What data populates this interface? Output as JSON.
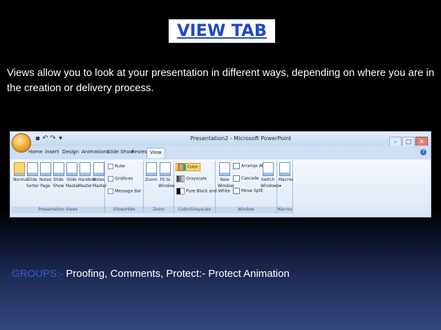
{
  "slide": {
    "title": "VIEW TAB",
    "intro": "Views allow you to look at your presentation in different ways, depending on where you are in the creation or delivery process.",
    "groups_label": "GROUPS:-",
    "groups_text": "Proofing, Comments, Protect:- Protect Animation"
  },
  "window": {
    "title": "Presentation2 - Microsoft PowerPoint",
    "tabs": [
      "Home",
      "Insert",
      "Design",
      "Animations",
      "Slide Show",
      "Review",
      "View"
    ],
    "active_tab": "View"
  },
  "ribbon": {
    "presentation_views": {
      "label": "Presentation Views",
      "buttons": [
        {
          "line1": "Normal",
          "line2": ""
        },
        {
          "line1": "Slide",
          "line2": "Sorter"
        },
        {
          "line1": "Notes",
          "line2": "Page"
        },
        {
          "line1": "Slide",
          "line2": "Show"
        },
        {
          "line1": "Slide",
          "line2": "Master"
        },
        {
          "line1": "Handout",
          "line2": "Master"
        },
        {
          "line1": "Notes",
          "line2": "Master"
        }
      ]
    },
    "show_hide": {
      "label": "Show/Hide",
      "items": [
        "Ruler",
        "Gridlines",
        "Message Bar"
      ]
    },
    "zoom": {
      "label": "Zoom",
      "buttons": [
        {
          "line1": "Zoom",
          "line2": ""
        },
        {
          "line1": "Fit to",
          "line2": "Window"
        }
      ]
    },
    "color_grayscale": {
      "label": "Color/Grayscale",
      "items": [
        "Color",
        "Grayscale",
        "Pure Black and White"
      ]
    },
    "window": {
      "label": "Window",
      "new_window": {
        "line1": "New",
        "line2": "Window"
      },
      "items": [
        "Arrange All",
        "Cascade",
        "Move Split"
      ],
      "switch": {
        "line1": "Switch",
        "line2": "Windows"
      }
    },
    "macros": {
      "label": "Macros",
      "button": {
        "line1": "Macros",
        "line2": ""
      }
    }
  }
}
